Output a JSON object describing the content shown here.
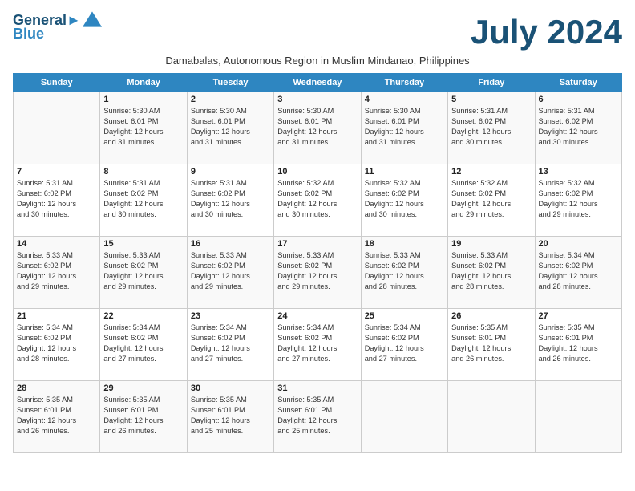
{
  "logo": {
    "line1": "General",
    "line2": "Blue"
  },
  "title": "July 2024",
  "subtitle": "Damabalas, Autonomous Region in Muslim Mindanao, Philippines",
  "weekdays": [
    "Sunday",
    "Monday",
    "Tuesday",
    "Wednesday",
    "Thursday",
    "Friday",
    "Saturday"
  ],
  "weeks": [
    [
      {
        "day": "",
        "info": ""
      },
      {
        "day": "1",
        "info": "Sunrise: 5:30 AM\nSunset: 6:01 PM\nDaylight: 12 hours\nand 31 minutes."
      },
      {
        "day": "2",
        "info": "Sunrise: 5:30 AM\nSunset: 6:01 PM\nDaylight: 12 hours\nand 31 minutes."
      },
      {
        "day": "3",
        "info": "Sunrise: 5:30 AM\nSunset: 6:01 PM\nDaylight: 12 hours\nand 31 minutes."
      },
      {
        "day": "4",
        "info": "Sunrise: 5:30 AM\nSunset: 6:01 PM\nDaylight: 12 hours\nand 31 minutes."
      },
      {
        "day": "5",
        "info": "Sunrise: 5:31 AM\nSunset: 6:02 PM\nDaylight: 12 hours\nand 30 minutes."
      },
      {
        "day": "6",
        "info": "Sunrise: 5:31 AM\nSunset: 6:02 PM\nDaylight: 12 hours\nand 30 minutes."
      }
    ],
    [
      {
        "day": "7",
        "info": "Sunrise: 5:31 AM\nSunset: 6:02 PM\nDaylight: 12 hours\nand 30 minutes."
      },
      {
        "day": "8",
        "info": "Sunrise: 5:31 AM\nSunset: 6:02 PM\nDaylight: 12 hours\nand 30 minutes."
      },
      {
        "day": "9",
        "info": "Sunrise: 5:31 AM\nSunset: 6:02 PM\nDaylight: 12 hours\nand 30 minutes."
      },
      {
        "day": "10",
        "info": "Sunrise: 5:32 AM\nSunset: 6:02 PM\nDaylight: 12 hours\nand 30 minutes."
      },
      {
        "day": "11",
        "info": "Sunrise: 5:32 AM\nSunset: 6:02 PM\nDaylight: 12 hours\nand 30 minutes."
      },
      {
        "day": "12",
        "info": "Sunrise: 5:32 AM\nSunset: 6:02 PM\nDaylight: 12 hours\nand 29 minutes."
      },
      {
        "day": "13",
        "info": "Sunrise: 5:32 AM\nSunset: 6:02 PM\nDaylight: 12 hours\nand 29 minutes."
      }
    ],
    [
      {
        "day": "14",
        "info": "Sunrise: 5:33 AM\nSunset: 6:02 PM\nDaylight: 12 hours\nand 29 minutes."
      },
      {
        "day": "15",
        "info": "Sunrise: 5:33 AM\nSunset: 6:02 PM\nDaylight: 12 hours\nand 29 minutes."
      },
      {
        "day": "16",
        "info": "Sunrise: 5:33 AM\nSunset: 6:02 PM\nDaylight: 12 hours\nand 29 minutes."
      },
      {
        "day": "17",
        "info": "Sunrise: 5:33 AM\nSunset: 6:02 PM\nDaylight: 12 hours\nand 29 minutes."
      },
      {
        "day": "18",
        "info": "Sunrise: 5:33 AM\nSunset: 6:02 PM\nDaylight: 12 hours\nand 28 minutes."
      },
      {
        "day": "19",
        "info": "Sunrise: 5:33 AM\nSunset: 6:02 PM\nDaylight: 12 hours\nand 28 minutes."
      },
      {
        "day": "20",
        "info": "Sunrise: 5:34 AM\nSunset: 6:02 PM\nDaylight: 12 hours\nand 28 minutes."
      }
    ],
    [
      {
        "day": "21",
        "info": "Sunrise: 5:34 AM\nSunset: 6:02 PM\nDaylight: 12 hours\nand 28 minutes."
      },
      {
        "day": "22",
        "info": "Sunrise: 5:34 AM\nSunset: 6:02 PM\nDaylight: 12 hours\nand 27 minutes."
      },
      {
        "day": "23",
        "info": "Sunrise: 5:34 AM\nSunset: 6:02 PM\nDaylight: 12 hours\nand 27 minutes."
      },
      {
        "day": "24",
        "info": "Sunrise: 5:34 AM\nSunset: 6:02 PM\nDaylight: 12 hours\nand 27 minutes."
      },
      {
        "day": "25",
        "info": "Sunrise: 5:34 AM\nSunset: 6:02 PM\nDaylight: 12 hours\nand 27 minutes."
      },
      {
        "day": "26",
        "info": "Sunrise: 5:35 AM\nSunset: 6:01 PM\nDaylight: 12 hours\nand 26 minutes."
      },
      {
        "day": "27",
        "info": "Sunrise: 5:35 AM\nSunset: 6:01 PM\nDaylight: 12 hours\nand 26 minutes."
      }
    ],
    [
      {
        "day": "28",
        "info": "Sunrise: 5:35 AM\nSunset: 6:01 PM\nDaylight: 12 hours\nand 26 minutes."
      },
      {
        "day": "29",
        "info": "Sunrise: 5:35 AM\nSunset: 6:01 PM\nDaylight: 12 hours\nand 26 minutes."
      },
      {
        "day": "30",
        "info": "Sunrise: 5:35 AM\nSunset: 6:01 PM\nDaylight: 12 hours\nand 25 minutes."
      },
      {
        "day": "31",
        "info": "Sunrise: 5:35 AM\nSunset: 6:01 PM\nDaylight: 12 hours\nand 25 minutes."
      },
      {
        "day": "",
        "info": ""
      },
      {
        "day": "",
        "info": ""
      },
      {
        "day": "",
        "info": ""
      }
    ]
  ]
}
